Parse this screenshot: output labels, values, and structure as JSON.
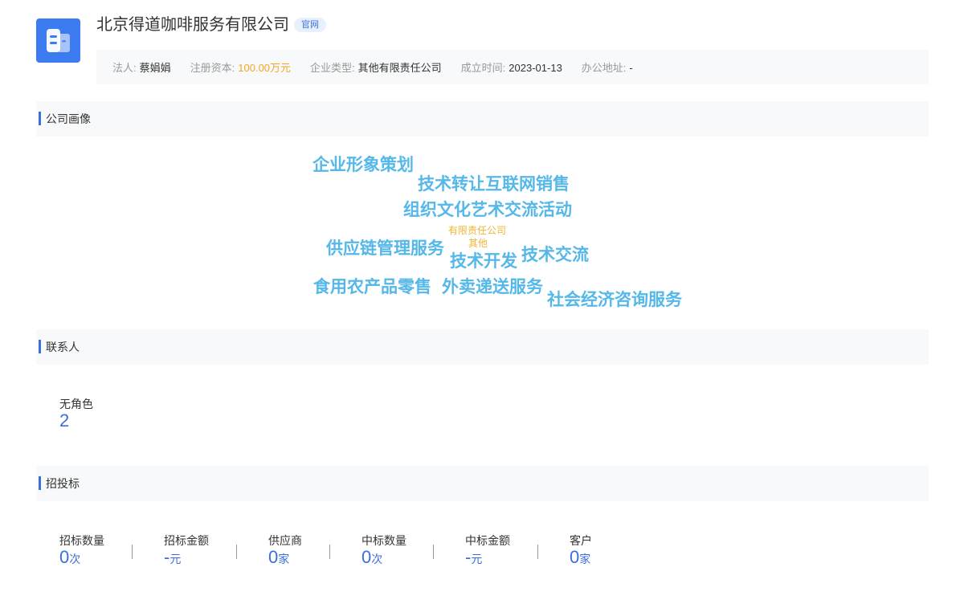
{
  "company": {
    "name": "北京得道咖啡服务有限公司",
    "badge": "官网"
  },
  "info": {
    "legal_label": "法人:",
    "legal_value": "蔡娟娟",
    "capital_label": "注册资本:",
    "capital_value": "100.00万元",
    "type_label": "企业类型:",
    "type_value": "其他有限责任公司",
    "founded_label": "成立时间:",
    "founded_value": "2023-01-13",
    "address_label": "办公地址:",
    "address_value": "-"
  },
  "sections": {
    "portrait": "公司画像",
    "contacts": "联系人",
    "bidding": "招投标"
  },
  "cloud_words": [
    "企业形象策划",
    "技术转让互联网销售",
    "组织文化艺术交流活动",
    "有限责任公司",
    "其他",
    "供应链管理服务",
    "技术开发",
    "技术交流",
    "食用农产品零售",
    "外卖递送服务",
    "社会经济咨询服务"
  ],
  "contacts": {
    "role_label": "无角色",
    "role_count": "2"
  },
  "bidding": [
    {
      "label": "招标数量",
      "value": "0",
      "unit": "次"
    },
    {
      "label": "招标金额",
      "value": "-",
      "unit": "元"
    },
    {
      "label": "供应商",
      "value": "0",
      "unit": "家"
    },
    {
      "label": "中标数量",
      "value": "0",
      "unit": "次"
    },
    {
      "label": "中标金额",
      "value": "-",
      "unit": "元"
    },
    {
      "label": "客户",
      "value": "0",
      "unit": "家"
    }
  ],
  "colors": {
    "accent": "#3d6fd8",
    "logo": "#3d7bf0",
    "cloud_primary": "#55b8e8",
    "cloud_secondary": "#f2b533",
    "capital": "#f5a623"
  }
}
